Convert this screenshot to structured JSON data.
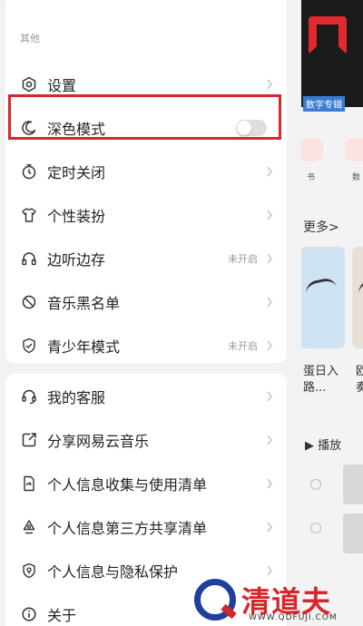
{
  "background_app": {
    "banner_tag": "数字专辑",
    "icon_caption_1": "书",
    "icon_caption_2": "数",
    "more_label": "更多>",
    "card_caption_1a": "蛋日入",
    "card_caption_1b": "路...",
    "card_caption_2a": "欧",
    "card_caption_2b": "奏",
    "play_label": "▶ 播放"
  },
  "drawer": {
    "section_label": "其他",
    "items_top": [
      {
        "label": "设置",
        "icon": "gear-icon",
        "status": ""
      },
      {
        "label": "深色模式",
        "icon": "moon-icon",
        "status": "",
        "toggle": false
      },
      {
        "label": "定时关闭",
        "icon": "timer-icon",
        "status": ""
      },
      {
        "label": "个性装扮",
        "icon": "tshirt-icon",
        "status": ""
      },
      {
        "label": "边听边存",
        "icon": "headphones-icon",
        "status": "未开启"
      },
      {
        "label": "音乐黑名单",
        "icon": "block-icon",
        "status": ""
      },
      {
        "label": "青少年模式",
        "icon": "shield-icon",
        "status": "未开启"
      }
    ],
    "items_bottom": [
      {
        "label": "我的客服",
        "icon": "headset-icon"
      },
      {
        "label": "分享网易云音乐",
        "icon": "share-icon"
      },
      {
        "label": "个人信息收集与使用清单",
        "icon": "document-icon"
      },
      {
        "label": "个人信息第三方共享清单",
        "icon": "recycle-icon"
      },
      {
        "label": "个人信息与隐私保护",
        "icon": "privacy-shield-icon"
      },
      {
        "label": "关于",
        "icon": "info-icon"
      }
    ]
  },
  "watermark": {
    "brand": "清道夫",
    "url": "WWW.QDFUJI.COM"
  },
  "colors": {
    "highlight": "#d7262b",
    "brand_blue": "#1f3fa0"
  }
}
